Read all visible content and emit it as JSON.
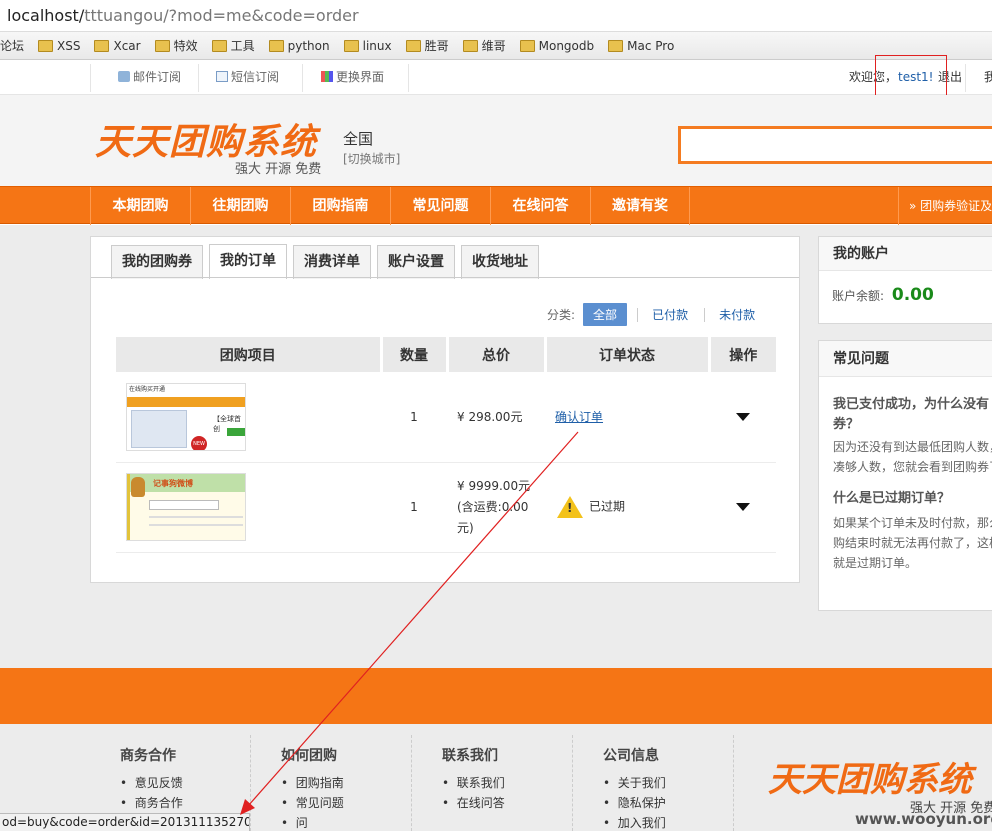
{
  "address": {
    "host": "localhost/",
    "path": "tttuangou/?mod=me&code=order"
  },
  "bookmarks": [
    "论坛",
    "XSS",
    "Xcar",
    "特效",
    "工具",
    "python",
    "linux",
    "胜哥",
    "维哥",
    "Mongodb",
    "Mac Pro"
  ],
  "topbar": {
    "email_sub": "邮件订阅",
    "sms_sub": "短信订阅",
    "theme": "更换界面",
    "welcome": "欢迎您，",
    "user": "test1!",
    "logout": "退出",
    "extra": "我"
  },
  "header": {
    "logo": "天天团购系统",
    "slogan": "强大 开源 免费",
    "city": "全国",
    "switch_city": "[切换城市]"
  },
  "nav": {
    "items": [
      "本期团购",
      "往期团购",
      "团购指南",
      "常见问题",
      "在线问答",
      "邀请有奖"
    ],
    "right": "» 团购券验证及"
  },
  "tabs": [
    "我的团购券",
    "我的订单",
    "消费详单",
    "账户设置",
    "收货地址"
  ],
  "filter": {
    "label": "分类:",
    "all": "全部",
    "paid": "已付款",
    "unpaid": "未付款"
  },
  "table": {
    "headers": [
      "团购项目",
      "数量",
      "总价",
      "订单状态",
      "操作"
    ],
    "rows": [
      {
        "qty": "1",
        "price": "¥ 298.00元",
        "price2": "",
        "status": "确认订单",
        "expired": false
      },
      {
        "qty": "1",
        "price": "¥ 9999.00元",
        "price2": "(含运费:0.00元)",
        "status": "已过期",
        "expired": true
      }
    ],
    "thumb1": {
      "top": "在线购买开通",
      "side": "【全球首创",
      "badge": "NEW"
    },
    "thumb2": {
      "title": "记事狗微博"
    }
  },
  "account": {
    "title": "我的账户",
    "balance_label": "账户余额:",
    "balance": "0.00"
  },
  "faq": {
    "title": "常见问题",
    "q1": "我已支付成功，为什么没有",
    "q1b": "券？",
    "a1a": "因为还没有到达最低团购人数，",
    "a1b": "凑够人数，您就会看到团购券了",
    "q2": "什么是已过期订单？",
    "a2a": "如果某个订单未及时付款，那么",
    "a2b": "购结束时就无法再付款了，这样",
    "a2c": "就是过期订单。"
  },
  "footer": {
    "cols": [
      {
        "title": "商务合作",
        "items": [
          "意见反馈",
          "商务合作"
        ]
      },
      {
        "title": "如何团购",
        "items": [
          "团购指南",
          "常见问题",
          "问"
        ]
      },
      {
        "title": "联系我们",
        "items": [
          "联系我们",
          "在线问答"
        ]
      },
      {
        "title": "公司信息",
        "items": [
          "关于我们",
          "隐私保护",
          "加入我们"
        ]
      }
    ],
    "logo": "天天团购系统",
    "slogan": "强大 开源 免费",
    "watermark": "www.wooyun.org"
  },
  "status_url": "od=buy&code=order&id=2013111352704",
  "colors": {
    "orange": "#f57515",
    "link": "#1f5fa8",
    "balance": "#1a8a1a",
    "annotation": "#e02020"
  }
}
